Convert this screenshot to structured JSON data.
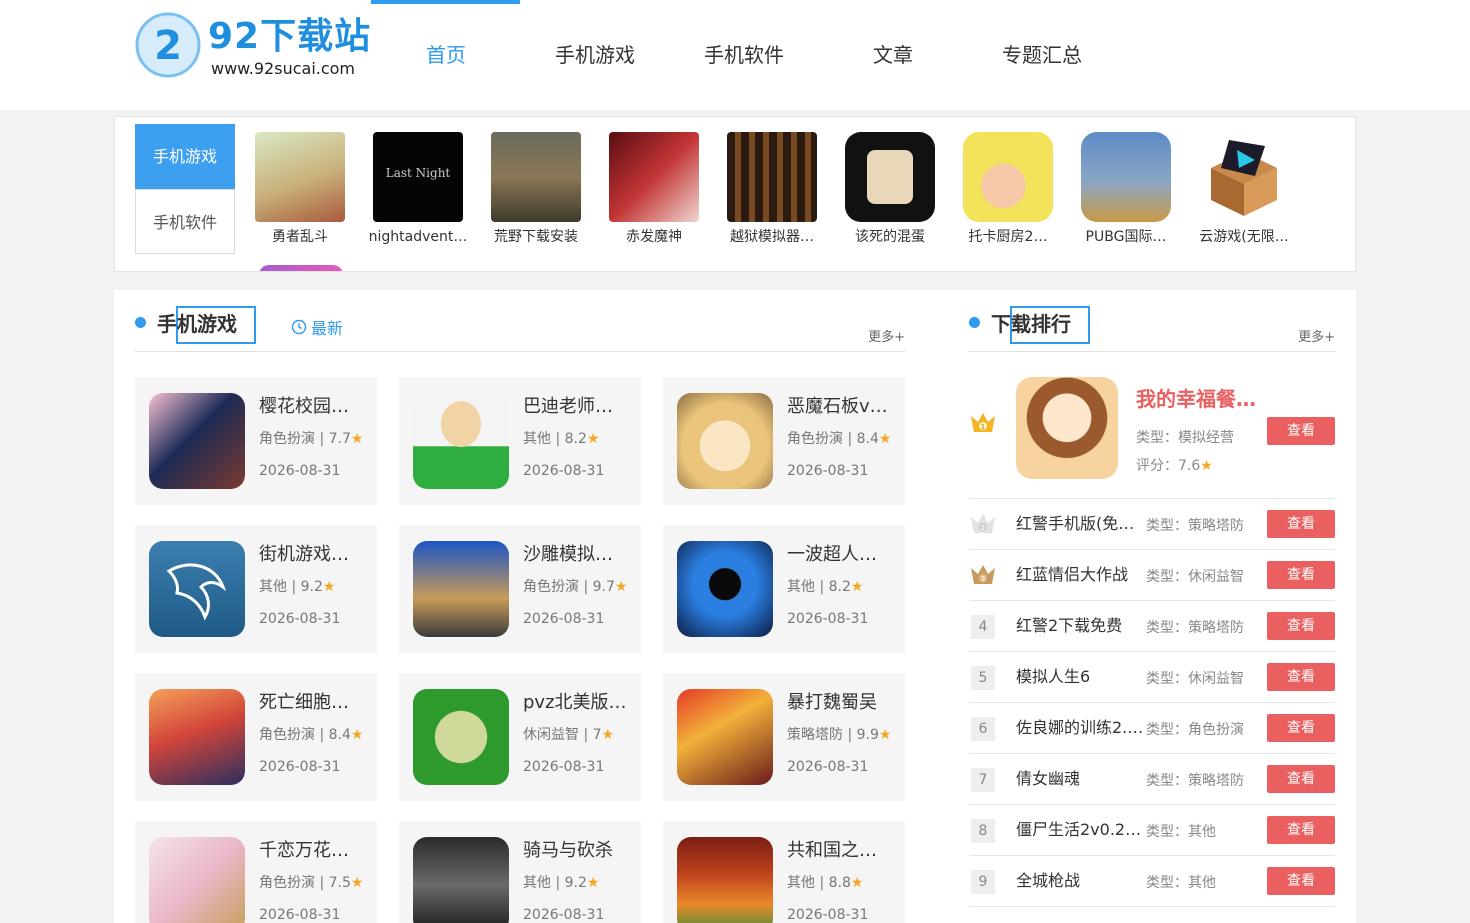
{
  "site": {
    "logo_title": "92下载站",
    "logo_url": "www.92sucai.com"
  },
  "nav": {
    "items": [
      {
        "label": "首页",
        "active": true
      },
      {
        "label": "手机游戏"
      },
      {
        "label": "手机软件"
      },
      {
        "label": "文章"
      },
      {
        "label": "专题汇总"
      }
    ]
  },
  "strip": {
    "tabs": [
      {
        "label": "手机游戏",
        "active": true
      },
      {
        "label": "手机软件"
      }
    ],
    "items": [
      {
        "name": "勇者乱斗"
      },
      {
        "name": "nightadvent…"
      },
      {
        "name": "荒野下载安装"
      },
      {
        "name": "赤发魔神"
      },
      {
        "name": "越狱模拟器…"
      },
      {
        "name": "该死的混蛋"
      },
      {
        "name": "托卡厨房2…"
      },
      {
        "name": "PUBG国际…"
      },
      {
        "name": "云游戏(无限…"
      }
    ]
  },
  "games": {
    "title": "手机游戏",
    "tab_latest": "最新",
    "more": "更多+",
    "items": [
      {
        "name": "樱花校园…",
        "meta": "角色扮演 | 7.7",
        "date": "2026-08-31"
      },
      {
        "name": "巴迪老师…",
        "meta": "其他 | 8.2",
        "date": "2026-08-31"
      },
      {
        "name": "恶魔石板v…",
        "meta": "角色扮演 | 8.4",
        "date": "2026-08-31"
      },
      {
        "name": "街机游戏…",
        "meta": "其他 | 9.2",
        "date": "2026-08-31"
      },
      {
        "name": "沙雕模拟…",
        "meta": "角色扮演 | 9.7",
        "date": "2026-08-31"
      },
      {
        "name": "一波超人…",
        "meta": "其他 | 8.2",
        "date": "2026-08-31"
      },
      {
        "name": "死亡细胞…",
        "meta": "角色扮演 | 8.4",
        "date": "2026-08-31"
      },
      {
        "name": "pvz北美版…",
        "meta": "休闲益智 | 7",
        "date": "2026-08-31"
      },
      {
        "name": "暴打魏蜀吴",
        "meta": "策略塔防 | 9.9",
        "date": "2026-08-31"
      },
      {
        "name": "千恋万花…",
        "meta": "角色扮演 | 7.5",
        "date": "2026-08-31"
      },
      {
        "name": "骑马与砍杀",
        "meta": "其他 | 9.2",
        "date": "2026-08-31"
      },
      {
        "name": "共和国之…",
        "meta": "其他 | 8.8",
        "date": "2026-08-31"
      }
    ]
  },
  "ranking": {
    "title": "下载排行",
    "more": "更多+",
    "view_label": "查看",
    "top": {
      "name": "我的幸福餐…",
      "type": "类型：模拟经营",
      "score": "评分：7.6"
    },
    "rows": [
      {
        "num": "2",
        "name": "红警手机版(免…",
        "type": "类型：策略塔防"
      },
      {
        "num": "3",
        "name": "红蓝情侣大作战",
        "type": "类型：休闲益智"
      },
      {
        "num": "4",
        "name": "红警2下载免费",
        "type": "类型：策略塔防"
      },
      {
        "num": "5",
        "name": "模拟人生6",
        "type": "类型：休闲益智"
      },
      {
        "num": "6",
        "name": "佐良娜的训练2.…",
        "type": "类型：角色扮演"
      },
      {
        "num": "7",
        "name": "倩女幽魂",
        "type": "类型：策略塔防"
      },
      {
        "num": "8",
        "name": "僵尸生活2v0.27…",
        "type": "类型：其他"
      },
      {
        "num": "9",
        "name": "全城枪战",
        "type": "类型：其他"
      }
    ]
  },
  "colors": {
    "accent": "#2e9bf0",
    "button": "#ea5f5f",
    "star": "#f5a623"
  }
}
